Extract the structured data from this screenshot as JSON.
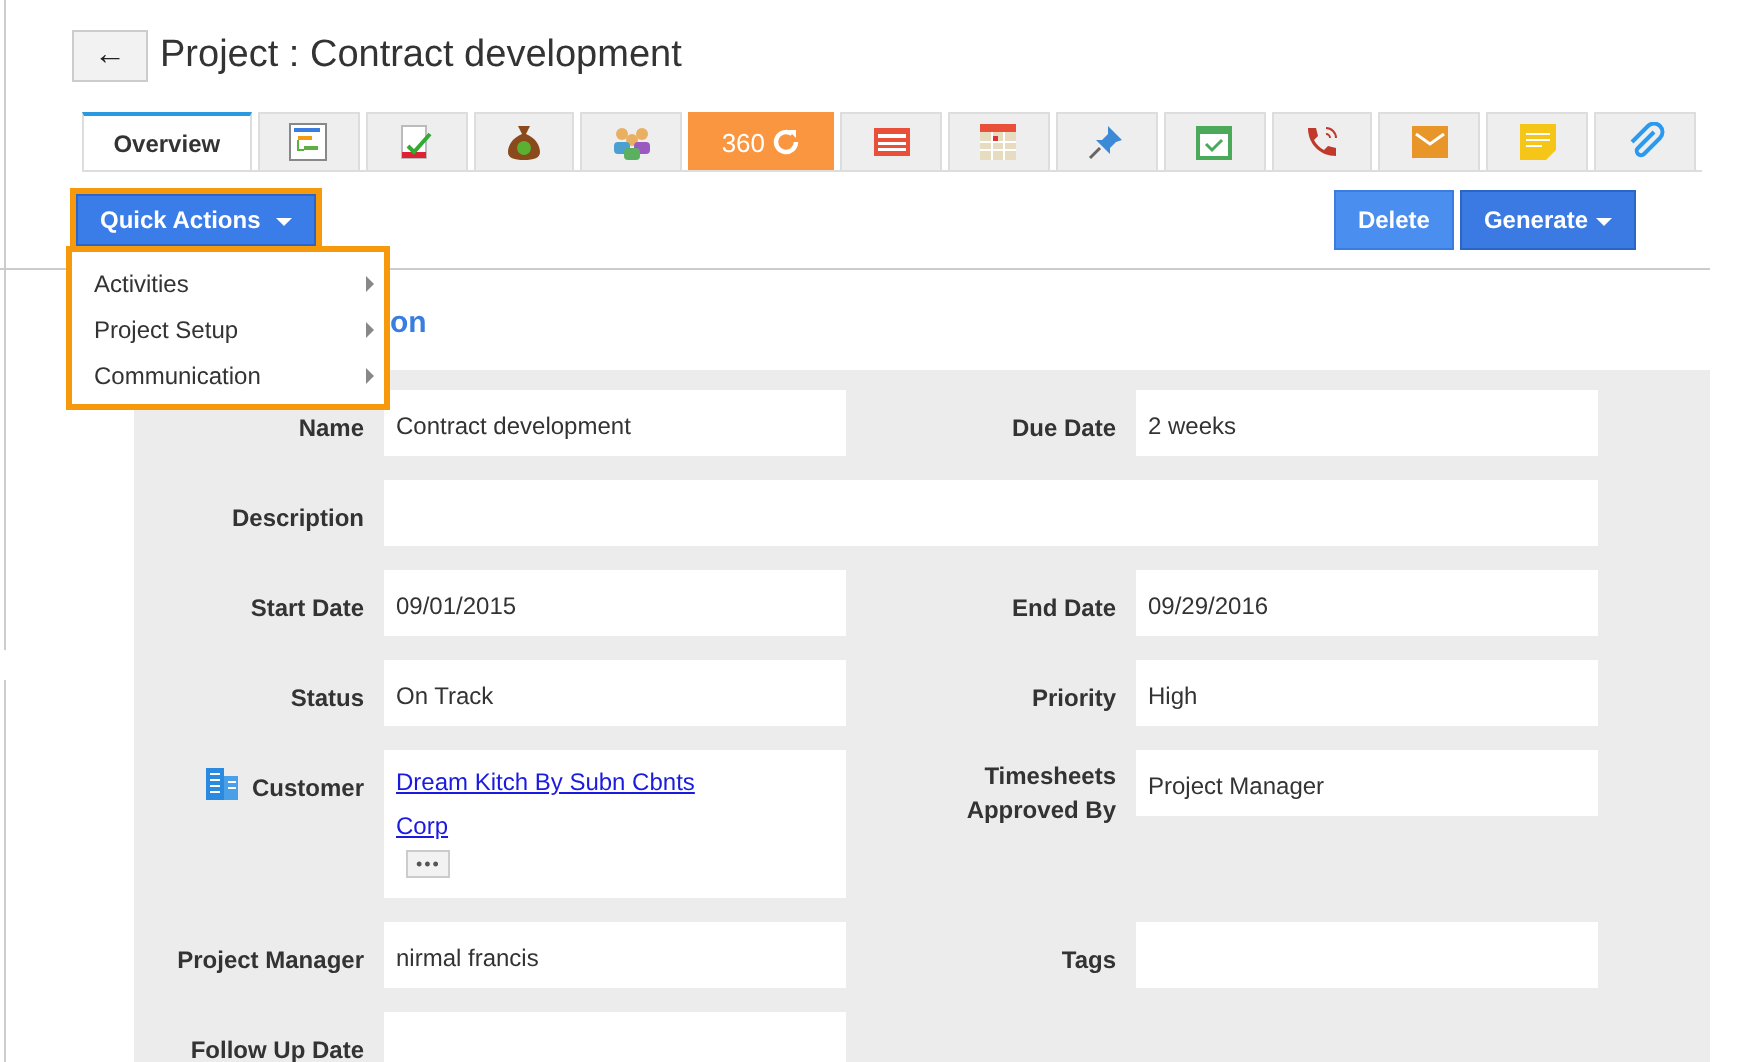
{
  "header": {
    "back_button": "←",
    "title": "Project : Contract development"
  },
  "tabs": [
    {
      "label": "Overview",
      "selected": true,
      "highlighted": false
    },
    {
      "selected": false,
      "highlighted": false
    },
    {
      "selected": false,
      "highlighted": false
    },
    {
      "selected": false,
      "highlighted": false
    },
    {
      "selected": false,
      "highlighted": false
    },
    {
      "label": "360",
      "selected": false,
      "highlighted": true
    },
    {
      "selected": false,
      "highlighted": false
    },
    {
      "selected": false,
      "highlighted": false
    },
    {
      "selected": false,
      "highlighted": false
    },
    {
      "selected": false,
      "highlighted": false
    },
    {
      "selected": false,
      "highlighted": false
    },
    {
      "selected": false,
      "highlighted": false
    },
    {
      "selected": false,
      "highlighted": false
    },
    {
      "selected": false,
      "highlighted": false
    }
  ],
  "quick_actions": {
    "label": "Quick Actions",
    "menu": [
      "Activities",
      "Project Setup",
      "Communication"
    ]
  },
  "buttons": [
    {
      "label": "Delete",
      "kind": "plain"
    },
    {
      "label": "Generate",
      "kind": "dropdown"
    }
  ],
  "section_heading": "on",
  "fields": [
    {
      "label": "Name",
      "value": "Contract development",
      "kind": "text"
    },
    {
      "label": "Due Date",
      "value": "2 weeks",
      "kind": "text"
    },
    {
      "label": "Description",
      "kind": "wide"
    },
    {
      "label": "Start Date",
      "value": "09/01/2015",
      "kind": "text"
    },
    {
      "label": "End Date",
      "value": "09/29/2016",
      "kind": "text"
    },
    {
      "label": "Status",
      "value": "On Track",
      "kind": "text"
    },
    {
      "label": "Priority",
      "value": "High",
      "kind": "text"
    },
    {
      "label": "Customer",
      "value": "Dream Kitch By Subn Cbnts Corp",
      "kind": "link",
      "more": "•••"
    },
    {
      "label": "Timesheets Approved By",
      "value": "Project Manager",
      "kind": "text"
    },
    {
      "label": "Project Manager",
      "value": "nirmal francis",
      "kind": "text"
    },
    {
      "label": "Tags",
      "kind": "text"
    },
    {
      "label": "Follow Up Date",
      "kind": "text"
    }
  ]
}
